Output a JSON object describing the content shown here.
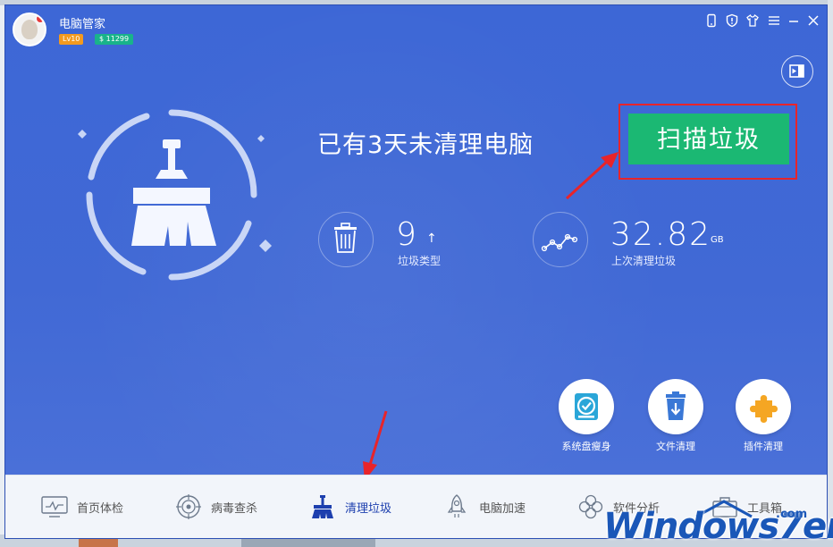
{
  "app": {
    "title": "电脑管家",
    "level_badge": "Lv10",
    "coin_badge": "$ 11299"
  },
  "titlebar_icons": [
    "phone-icon",
    "shield-icon",
    "shirt-icon",
    "menu-icon",
    "minimize-icon",
    "close-icon"
  ],
  "headline": "已有3天未清理电脑",
  "scan_button": "扫描垃圾",
  "stats": {
    "types": {
      "value": "9",
      "arrow": "↑",
      "label": "垃圾类型"
    },
    "last": {
      "value": "32.82",
      "unit": "GB",
      "label": "上次清理垃圾"
    }
  },
  "tools": [
    {
      "label": "系统盘瘦身",
      "icon": "disk-check-icon"
    },
    {
      "label": "文件清理",
      "icon": "file-trash-icon"
    },
    {
      "label": "插件清理",
      "icon": "puzzle-icon"
    }
  ],
  "nav": [
    {
      "label": "首页体检",
      "icon": "monitor-icon"
    },
    {
      "label": "病毒查杀",
      "icon": "crosshair-icon"
    },
    {
      "label": "清理垃圾",
      "icon": "broom-icon",
      "active": true
    },
    {
      "label": "电脑加速",
      "icon": "rocket-icon"
    },
    {
      "label": "软件分析",
      "icon": "flower-icon"
    },
    {
      "label": "工具箱",
      "icon": "toolbox-icon"
    }
  ],
  "watermark": {
    "text": "Windows7en",
    "suffix": ".com"
  },
  "colors": {
    "window_blue": "#3b64d4",
    "scan_green": "#1bb873",
    "highlight_red": "#e8242a",
    "nav_active": "#1d3fae"
  }
}
